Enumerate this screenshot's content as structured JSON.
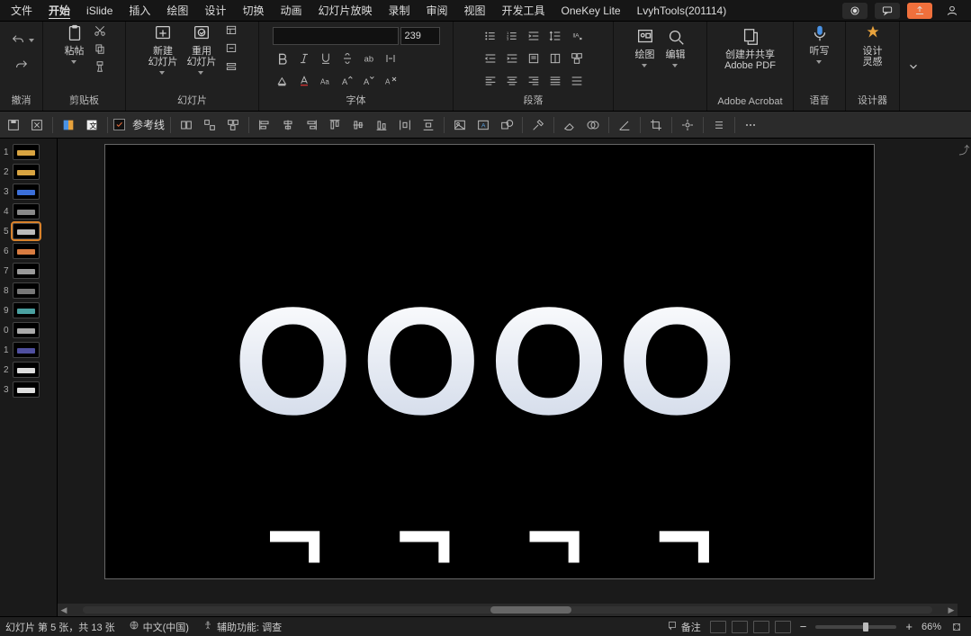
{
  "menu": {
    "items": [
      "文件",
      "开始",
      "iSlide",
      "插入",
      "绘图",
      "设计",
      "切换",
      "动画",
      "幻灯片放映",
      "录制",
      "审阅",
      "视图",
      "开发工具",
      "OneKey Lite",
      "LvyhTools(201114)"
    ],
    "active_index": 1
  },
  "ribbon": {
    "undo": {
      "label": "撤消"
    },
    "clipboard": {
      "paste": "粘帖",
      "label": "剪贴板"
    },
    "slides": {
      "new": "新建\n幻灯片",
      "reuse": "重用\n幻灯片",
      "label": "幻灯片"
    },
    "font": {
      "size": "239",
      "label": "字体"
    },
    "paragraph": {
      "label": "段落"
    },
    "drawing": {
      "draw": "绘图",
      "edit": "编辑"
    },
    "adobe": {
      "btn": "创建并共享\nAdobe PDF",
      "label": "Adobe Acrobat"
    },
    "voice": {
      "btn": "听写",
      "label": "语音"
    },
    "designer": {
      "btn": "设计\n灵感",
      "label": "设计器"
    }
  },
  "toolbar": {
    "guides": "参考线"
  },
  "thumbs": {
    "list": [
      {
        "n": "1",
        "bg": "#000",
        "bar": "#d9a441"
      },
      {
        "n": "2",
        "bg": "#000",
        "bar": "#d9a441"
      },
      {
        "n": "3",
        "bg": "#000",
        "bar": "#3b6fd9"
      },
      {
        "n": "4",
        "bg": "#000",
        "bar": "#888"
      },
      {
        "n": "5",
        "bg": "#000",
        "bar": "#bbb",
        "sel": true
      },
      {
        "n": "6",
        "bg": "#000",
        "bar": "#d97c41"
      },
      {
        "n": "7",
        "bg": "#000",
        "bar": "#999"
      },
      {
        "n": "8",
        "bg": "#000",
        "bar": "#777"
      },
      {
        "n": "9",
        "bg": "#000",
        "bar": "#4aa0a0"
      },
      {
        "n": "0",
        "bg": "#000",
        "bar": "#aaa"
      },
      {
        "n": "1",
        "bg": "#000",
        "bar": "#5050a0"
      },
      {
        "n": "2",
        "bg": "#000",
        "bar": "#ddd"
      },
      {
        "n": "3",
        "bg": "#000",
        "bar": "#ddd"
      }
    ]
  },
  "slide": {
    "big": "OOOO"
  },
  "status": {
    "pos": "幻灯片 第 5 张，共 13 张",
    "lang_icon": "",
    "lang": "中文(中国)",
    "acc": "辅助功能: 调查",
    "notes": "备注",
    "zoom": "66%"
  }
}
